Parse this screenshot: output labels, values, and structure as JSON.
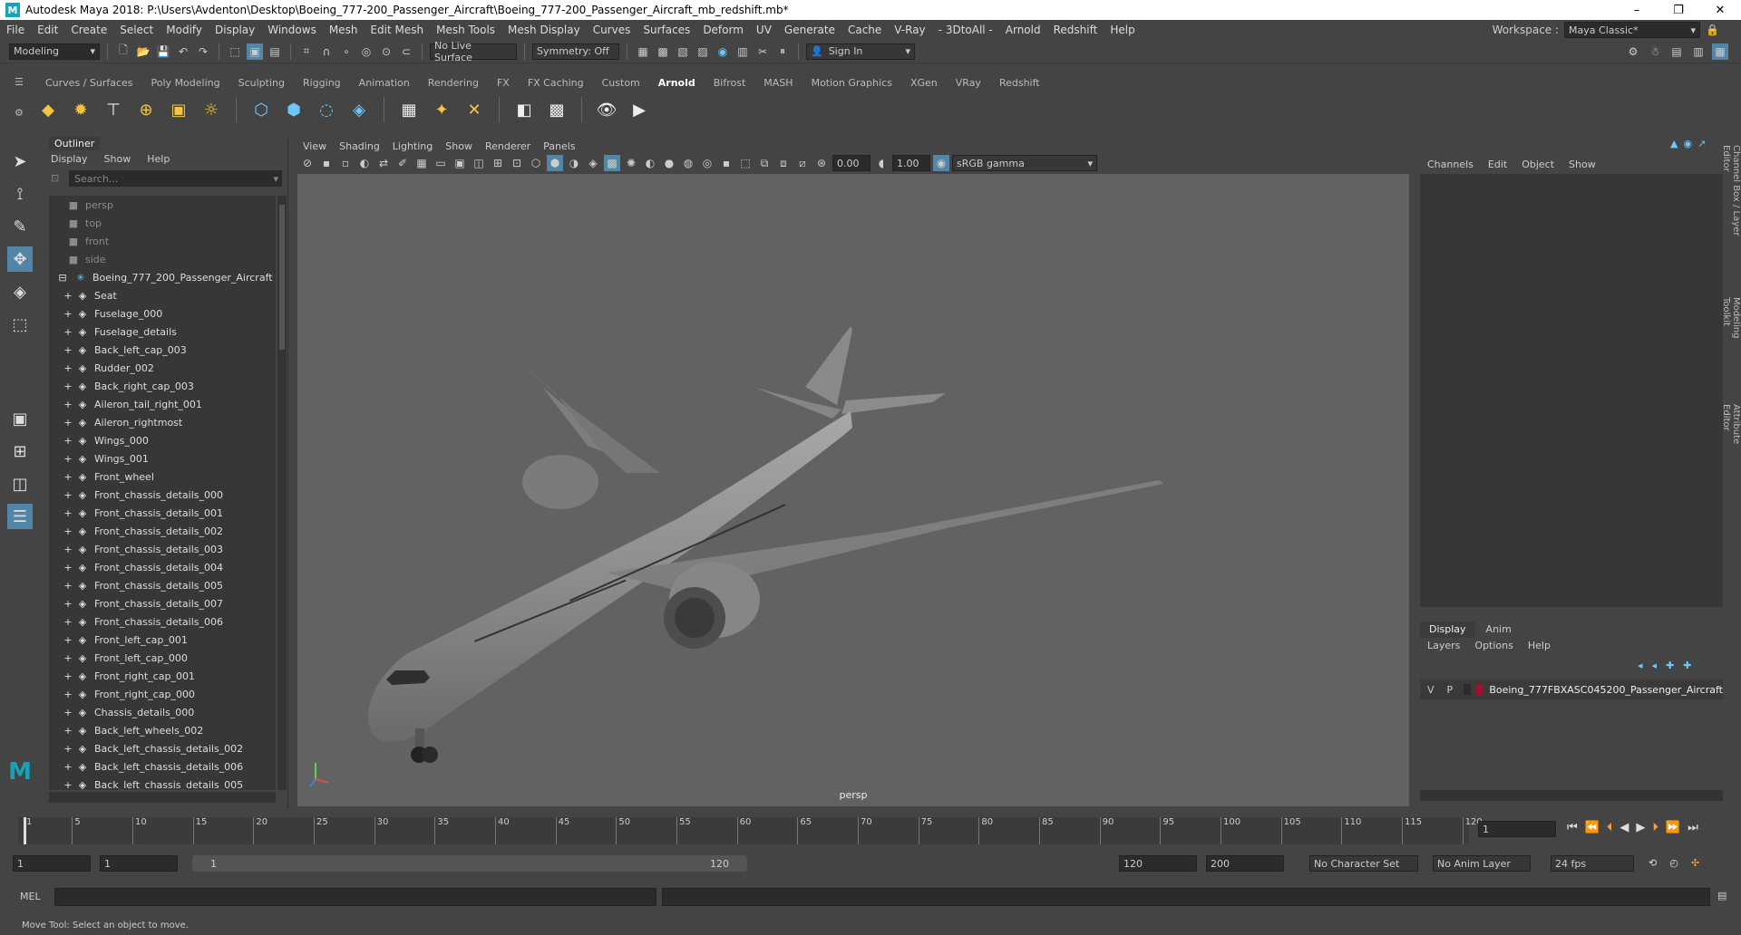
{
  "window": {
    "title": "Autodesk Maya 2018: P:\\Users\\Avdenton\\Desktop\\Boeing_777-200_Passenger_Aircraft\\Boeing_777-200_Passenger_Aircraft_mb_redshift.mb*"
  },
  "menus": [
    "File",
    "Edit",
    "Create",
    "Select",
    "Modify",
    "Display",
    "Windows",
    "Mesh",
    "Edit Mesh",
    "Mesh Tools",
    "Mesh Display",
    "Curves",
    "Surfaces",
    "Deform",
    "UV",
    "Generate",
    "Cache",
    "V-Ray",
    "- 3DtoAll -",
    "Arnold",
    "Redshift",
    "Help"
  ],
  "workspace": {
    "label": "Workspace :",
    "value": "Maya Classic*"
  },
  "status": {
    "mode": "Modeling",
    "live_surface": "No Live Surface",
    "symmetry": "Symmetry: Off",
    "sign_in": "Sign In"
  },
  "shelf_tabs": [
    "Curves / Surfaces",
    "Poly Modeling",
    "Sculpting",
    "Rigging",
    "Animation",
    "Rendering",
    "FX",
    "FX Caching",
    "Custom",
    "Arnold",
    "Bifrost",
    "MASH",
    "Motion Graphics",
    "XGen",
    "VRay",
    "Redshift"
  ],
  "active_shelf": "Arnold",
  "outliner": {
    "title": "Outliner",
    "menus": [
      "Display",
      "Show",
      "Help"
    ],
    "search_placeholder": "Search...",
    "items": [
      {
        "label": "persp",
        "dim": true
      },
      {
        "label": "top",
        "dim": true
      },
      {
        "label": "front",
        "dim": true
      },
      {
        "label": "side",
        "dim": true
      },
      {
        "label": "Boeing_777_200_Passenger_Aircraft",
        "group": true
      },
      {
        "label": "Seat"
      },
      {
        "label": "Fuselage_000"
      },
      {
        "label": "Fuselage_details"
      },
      {
        "label": "Back_left_cap_003"
      },
      {
        "label": "Rudder_002"
      },
      {
        "label": "Back_right_cap_003"
      },
      {
        "label": "Aileron_tail_right_001"
      },
      {
        "label": "Aileron_rightmost"
      },
      {
        "label": "Wings_000"
      },
      {
        "label": "Wings_001"
      },
      {
        "label": "Front_wheel"
      },
      {
        "label": "Front_chassis_details_000"
      },
      {
        "label": "Front_chassis_details_001"
      },
      {
        "label": "Front_chassis_details_002"
      },
      {
        "label": "Front_chassis_details_003"
      },
      {
        "label": "Front_chassis_details_004"
      },
      {
        "label": "Front_chassis_details_005"
      },
      {
        "label": "Front_chassis_details_007"
      },
      {
        "label": "Front_chassis_details_006"
      },
      {
        "label": "Front_left_cap_001"
      },
      {
        "label": "Front_left_cap_000"
      },
      {
        "label": "Front_right_cap_001"
      },
      {
        "label": "Front_right_cap_000"
      },
      {
        "label": "Chassis_details_000"
      },
      {
        "label": "Back_left_wheels_002"
      },
      {
        "label": "Back_left_chassis_details_002"
      },
      {
        "label": "Back_left_chassis_details_006"
      },
      {
        "label": "Back_left_chassis_details_005"
      }
    ]
  },
  "viewport": {
    "menus": [
      "View",
      "Shading",
      "Lighting",
      "Show",
      "Renderer",
      "Panels"
    ],
    "exposure": "0.00",
    "gamma": "1.00",
    "color_space": "sRGB gamma",
    "camera": "persp"
  },
  "channelbox": {
    "menus": [
      "Channels",
      "Edit",
      "Object",
      "Show"
    ],
    "layer_tabs": [
      "Display",
      "Anim"
    ],
    "layer_menus": [
      "Layers",
      "Options",
      "Help"
    ],
    "layer": {
      "v": "V",
      "p": "P",
      "name": "Boeing_777FBXASC045200_Passenger_Aircraft",
      "color": "#a1102f"
    }
  },
  "side_tabs": [
    "Channel Box / Layer Editor",
    "Modeling Toolkit",
    "Attribute Editor"
  ],
  "timeline": {
    "ticks": [
      "1",
      "5",
      "10",
      "15",
      "20",
      "25",
      "30",
      "35",
      "40",
      "45",
      "50",
      "55",
      "60",
      "65",
      "70",
      "75",
      "80",
      "85",
      "90",
      "95",
      "100",
      "105",
      "110",
      "115",
      "120"
    ],
    "current": "1"
  },
  "range": {
    "start": "1",
    "start2": "1",
    "slider_start": "1",
    "slider_end": "120",
    "end": "120",
    "end2": "200",
    "character_set": "No Character Set",
    "anim_layer": "No Anim Layer",
    "fps": "24 fps"
  },
  "command": {
    "label": "MEL"
  },
  "help": "Move Tool: Select an object to move."
}
